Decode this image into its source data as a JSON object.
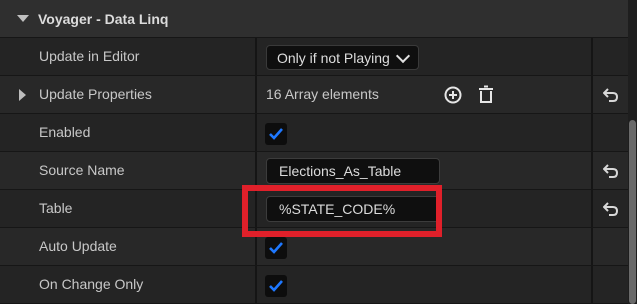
{
  "section": {
    "title": "Voyager - Data Linq"
  },
  "rows": [
    {
      "label": "Update in Editor",
      "value": "Only if not Playing"
    },
    {
      "label": "Update Properties",
      "value": "16 Array elements"
    },
    {
      "label": "Enabled",
      "checked": true
    },
    {
      "label": "Source Name",
      "value": "Elections_As_Table"
    },
    {
      "label": "Table",
      "value": "%STATE_CODE%"
    },
    {
      "label": "Auto Update",
      "checked": true
    },
    {
      "label": "On Change Only",
      "checked": true
    }
  ],
  "icons": {
    "section_toggle": "collapse-triangle-icon",
    "expander": "expand-arrow-icon",
    "add": "add-element-icon",
    "delete": "trash-icon",
    "reset": "reset-to-default-icon",
    "checkmark": "checkmark-icon"
  },
  "colors": {
    "accent_check": "#1e78ff",
    "highlight": "#e0202a",
    "background": "#242424"
  }
}
